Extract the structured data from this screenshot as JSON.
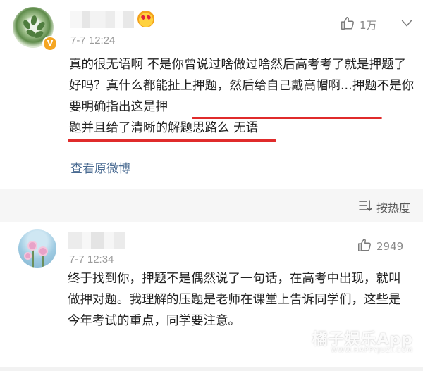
{
  "post": {
    "time": "7-7 12:24",
    "verified_badge": "V",
    "like_count": "1万",
    "text_plain": "真的很无语啊  不是你曾说过啥做过啥然后高考考了就是押题了好吗？真什么都能扯上押题，然后给自己戴高帽啊...",
    "text_underlined_1": "押题不是你要明确指出这是押",
    "text_underlined_2": "题并且给了清晰的解题思路么",
    "text_tail": " 无语",
    "view_original": "查看原微博",
    "underline_color": "#e02b2b"
  },
  "sort": {
    "label": "按热度",
    "icon": "sort-lines-icon"
  },
  "comment": {
    "time": "7-7 12:34",
    "like_count": "2949",
    "text": "终于找到你，押题不是偶然说了一句话，在高考中出现，就叫做押对题。我理解的压题是老师在课堂上告诉同学们，这些是今年考试的重点，同学要注意。"
  },
  "watermark": {
    "main": "橘子娱乐App",
    "sub": "WWW.HAPPYJUZI.COM"
  },
  "colors": {
    "link": "#4a6b92",
    "meta_gray": "#9b9b9b",
    "divider_bg": "#f6f6f6"
  }
}
